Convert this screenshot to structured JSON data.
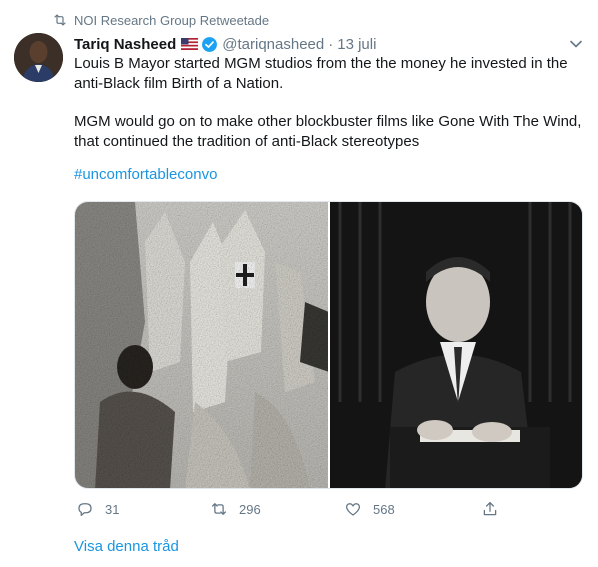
{
  "retweet_banner": {
    "icon": "retweet-icon",
    "text": "NOI Research Group Retweetade"
  },
  "author": {
    "display_name": "Tariq Nasheed",
    "flag_icon": "us-flag-icon",
    "verified_icon": "verified-badge-icon",
    "handle": "@tariqnasheed",
    "separator": "·",
    "date": "13 juli"
  },
  "tweet": {
    "paragraph_1": "Louis B Mayor started MGM studios from the the money he invested in the anti-Black film Birth of a Nation.",
    "paragraph_2": "MGM would go on to make other blockbuster films like Gone With The Wind, that continued the tradition of anti-Black stereotypes",
    "hashtag": "#uncomfortableconvo"
  },
  "media": {
    "left_image": "black-and-white film still with hooded klansmen",
    "right_image": "black-and-white portrait of man at desk"
  },
  "actions": {
    "reply_count": "31",
    "retweet_count": "296",
    "like_count": "568",
    "reply_icon": "reply-icon",
    "retweet_icon": "retweet-icon",
    "like_icon": "heart-icon",
    "share_icon": "share-icon"
  },
  "show_thread": "Visa denna tråd",
  "colors": {
    "link": "#1b95e0",
    "secondary_text": "#657786",
    "primary_text": "#14171a"
  }
}
